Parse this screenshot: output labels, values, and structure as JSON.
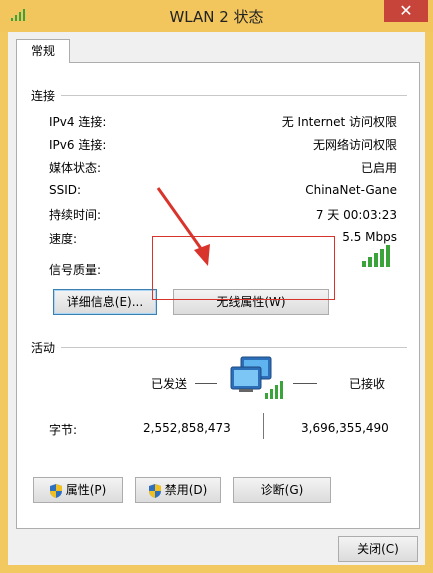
{
  "window": {
    "title": "WLAN 2 状态",
    "close_glyph": "✕"
  },
  "tab": {
    "label": "常规"
  },
  "connection": {
    "group_label": "连接",
    "rows": [
      {
        "label": "IPv4 连接:",
        "value": "无 Internet 访问权限"
      },
      {
        "label": "IPv6 连接:",
        "value": "无网络访问权限"
      },
      {
        "label": "媒体状态:",
        "value": "已启用"
      },
      {
        "label": "SSID:",
        "value": "ChinaNet-Gane"
      },
      {
        "label": "持续时间:",
        "value": "7 天 00:03:23"
      },
      {
        "label": "速度:",
        "value": "5.5 Mbps"
      }
    ],
    "signal_label": "信号质量:",
    "signal_bars": 5,
    "details_button": "详细信息(E)...",
    "wireless_props_button": "无线属性(W)"
  },
  "activity": {
    "group_label": "活动",
    "sent_label": "已发送",
    "received_label": "已接收",
    "bytes_label": "字节:",
    "bytes_sent": "2,552,858,473",
    "bytes_received": "3,696,355,490"
  },
  "buttons": {
    "properties": "属性(P)",
    "disable": "禁用(D)",
    "diagnose": "诊断(G)",
    "close": "关闭(C)"
  },
  "colors": {
    "accent_orange": "#f2c65c",
    "signal_green": "#3aa33a",
    "annotation_red": "#d9342b"
  }
}
